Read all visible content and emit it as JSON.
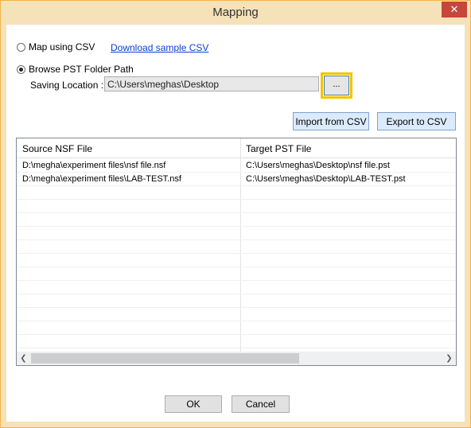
{
  "window": {
    "title": "Mapping",
    "close_icon": "close-icon",
    "close_glyph": "✕"
  },
  "options": {
    "map_csv_label": "Map using CSV",
    "download_link": "Download sample CSV",
    "browse_label": "Browse PST Folder Path",
    "selected": "browse"
  },
  "saving": {
    "label": "Saving Location :",
    "path": "C:\\Users\\meghas\\Desktop",
    "browse_button": "..."
  },
  "buttons": {
    "import": "Import from CSV",
    "export": "Export to CSV",
    "ok": "OK",
    "cancel": "Cancel"
  },
  "grid": {
    "columns": [
      "Source NSF File",
      "Target PST File"
    ],
    "rows": [
      [
        "D:\\megha\\experiment files\\nsf file.nsf",
        "C:\\Users\\meghas\\Desktop\\nsf file.pst"
      ],
      [
        "D:\\megha\\experiment files\\LAB-TEST.nsf",
        "C:\\Users\\meghas\\Desktop\\LAB-TEST.pst"
      ]
    ],
    "scroll_left_glyph": "❮",
    "scroll_right_glyph": "❯"
  },
  "colors": {
    "accent": "#f5c200",
    "link": "#0d3dd6",
    "window_border": "#f4b24a"
  }
}
